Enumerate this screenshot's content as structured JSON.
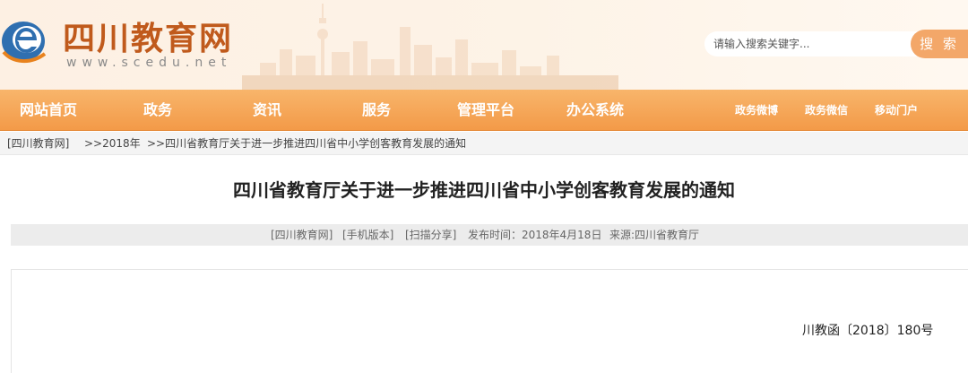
{
  "header": {
    "site_title": "四川教育网",
    "site_url": "www.scedu.net",
    "logo_icon": "e-logo-icon",
    "search": {
      "placeholder": "请输入搜索关键字...",
      "button_label": "搜 索"
    }
  },
  "nav": {
    "items": [
      {
        "label": "网站首页"
      },
      {
        "label": "政务"
      },
      {
        "label": "资讯"
      },
      {
        "label": "服务"
      },
      {
        "label": "管理平台"
      },
      {
        "label": "办公系统"
      }
    ],
    "right_items": [
      {
        "label": "政务微博"
      },
      {
        "label": "政务微信"
      },
      {
        "label": "移动门户"
      }
    ]
  },
  "breadcrumb": [
    "[四川教育网]",
    ">>2018年",
    ">>四川省教育厅关于进一步推进四川省中小学创客教育发展的通知"
  ],
  "article": {
    "title": "四川省教育厅关于进一步推进四川省中小学创客教育发展的通知",
    "meta": {
      "site_link": "[四川教育网]",
      "mobile_link": "[手机版本]",
      "share_link": "[扫描分享]",
      "publish_label": "发布时间：2018年4月18日",
      "source_label": "来源:四川省教育厅"
    },
    "doc_number": "川教函〔2018〕180号"
  },
  "colors": {
    "brand": "#c05a1c",
    "nav_orange": "#f39a48",
    "search_button": "#f3a769",
    "header_bg": "#fdf0e3"
  }
}
